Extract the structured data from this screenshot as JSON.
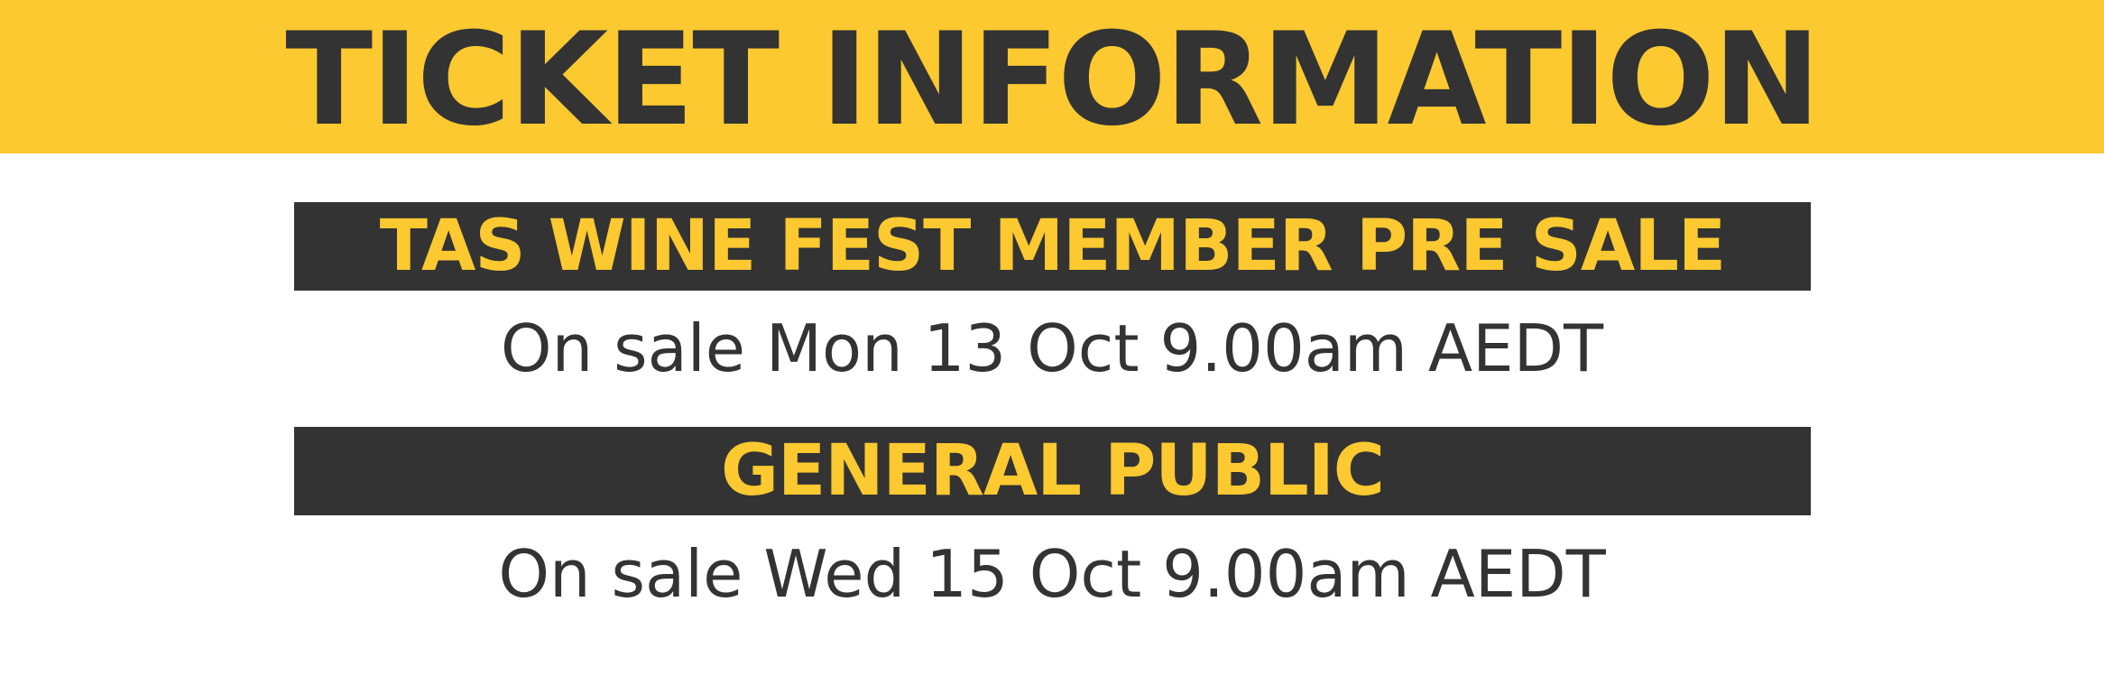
{
  "header": {
    "title": "TICKET INFORMATION"
  },
  "sections": [
    {
      "heading": "TAS WINE FEST MEMBER PRE SALE",
      "sale_text": "On sale Mon 13 Oct 9.00am AEDT"
    },
    {
      "heading": "GENERAL PUBLIC",
      "sale_text": "On sale Wed 15 Oct 9.00am AEDT"
    }
  ],
  "colors": {
    "accent_yellow": "#FCC930",
    "dark_charcoal": "#333333",
    "background": "#FFFFFF"
  }
}
